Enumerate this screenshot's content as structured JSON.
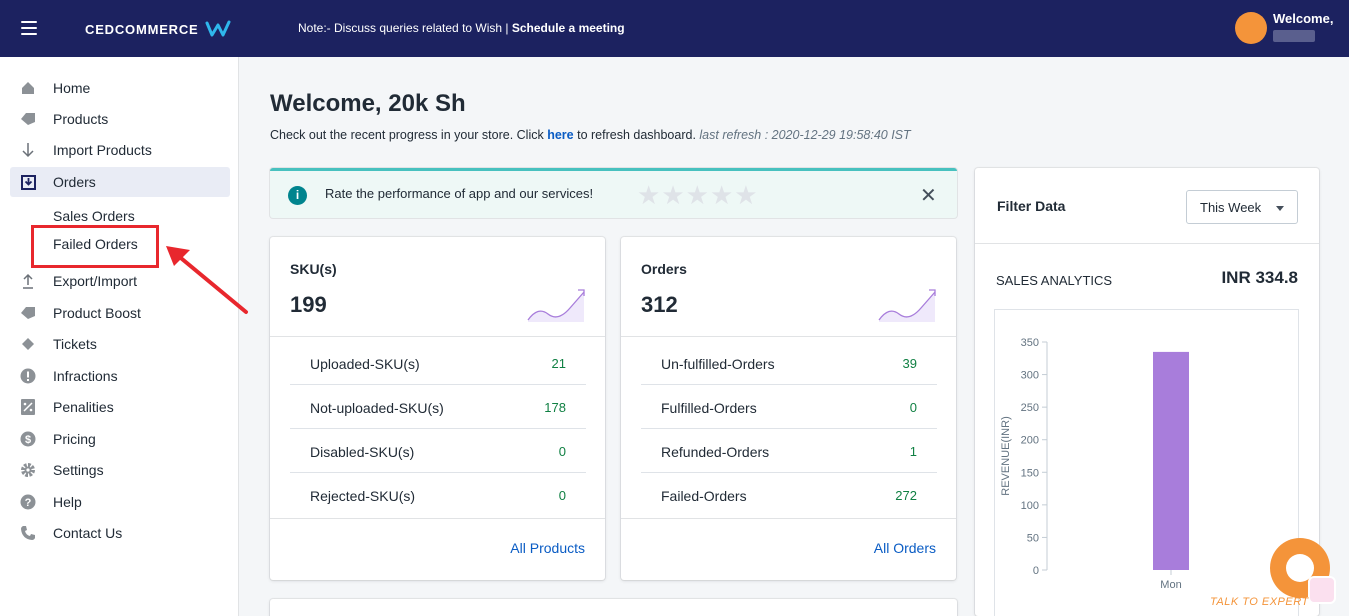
{
  "header": {
    "brand": "CEDCOMMERCE",
    "note_prefix": "Note:- Discuss queries related to Wish | ",
    "note_link": "Schedule a meeting",
    "welcome": "Welcome,"
  },
  "sidebar": {
    "items": [
      {
        "label": "Home",
        "icon": "home-icon"
      },
      {
        "label": "Products",
        "icon": "tag-icon"
      },
      {
        "label": "Import Products",
        "icon": "arrow-down-icon"
      },
      {
        "label": "Orders",
        "icon": "inbox-icon"
      },
      {
        "label": "Export/Import",
        "icon": "upload-icon"
      },
      {
        "label": "Product Boost",
        "icon": "tag-icon"
      },
      {
        "label": "Tickets",
        "icon": "ticket-icon"
      },
      {
        "label": "Infractions",
        "icon": "alert-icon"
      },
      {
        "label": "Penalities",
        "icon": "percent-icon"
      },
      {
        "label": "Pricing",
        "icon": "dollar-icon"
      },
      {
        "label": "Settings",
        "icon": "gear-icon"
      },
      {
        "label": "Help",
        "icon": "help-icon"
      },
      {
        "label": "Contact Us",
        "icon": "phone-icon"
      }
    ],
    "sub_items": [
      "Sales Orders",
      "Failed Orders"
    ]
  },
  "main": {
    "title": "Welcome, 20k Sh",
    "subline_pre": "Check out the recent progress in your store. Click ",
    "subline_link": "here",
    "subline_post": " to refresh dashboard. ",
    "last_refresh": "last refresh : 2020-12-29 19:58:40 IST",
    "banner_text": "Rate the performance of app and our services!",
    "banner_close": "✕",
    "rating_stars": 5
  },
  "sku_card": {
    "title": "SKU(s)",
    "total": "199",
    "rows": [
      {
        "label": "Uploaded-SKU(s)",
        "value": "21"
      },
      {
        "label": "Not-uploaded-SKU(s)",
        "value": "178"
      },
      {
        "label": "Disabled-SKU(s)",
        "value": "0"
      },
      {
        "label": "Rejected-SKU(s)",
        "value": "0"
      }
    ],
    "link": "All Products"
  },
  "orders_card": {
    "title": "Orders",
    "total": "312",
    "rows": [
      {
        "label": "Un-fulfilled-Orders",
        "value": "39"
      },
      {
        "label": "Fulfilled-Orders",
        "value": "0"
      },
      {
        "label": "Refunded-Orders",
        "value": "1"
      },
      {
        "label": "Failed-Orders",
        "value": "272"
      }
    ],
    "link": "All Orders"
  },
  "filter": {
    "title": "Filter Data",
    "selected": "This Week",
    "sales_label": "SALES ANALYTICS",
    "sales_value": "INR 334.8"
  },
  "chart_data": {
    "type": "bar",
    "categories": [
      "Mon"
    ],
    "values": [
      334.8
    ],
    "ylabel": "REVENUE(INR)",
    "ylim": [
      0,
      350
    ],
    "yticks": [
      0,
      50,
      100,
      150,
      200,
      250,
      300,
      350
    ],
    "bar_color": "#a87ddb"
  },
  "chat": {
    "label": "TALK TO EXPERT"
  }
}
